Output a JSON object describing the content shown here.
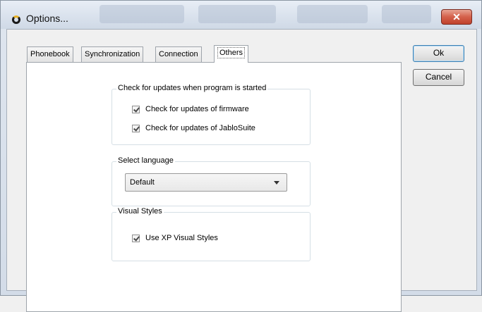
{
  "window": {
    "title": "Options...",
    "close_label": "✕",
    "close_color": "#c0422c"
  },
  "tabs": [
    {
      "label": "Phonebook",
      "active": false
    },
    {
      "label": "Synchronization",
      "active": false
    },
    {
      "label": "Connection",
      "active": false
    },
    {
      "label": "Others",
      "active": true
    }
  ],
  "buttons": {
    "ok_label": "Ok",
    "cancel_label": "Cancel"
  },
  "updates_group": {
    "label": "Check for updates when program is started",
    "items": [
      {
        "label": "Check for updates of firmware",
        "checked": true
      },
      {
        "label": "Check for updates of JabloSuite",
        "checked": true
      }
    ]
  },
  "language_group": {
    "label": "Select language",
    "selected": "Default"
  },
  "styles_group": {
    "label": "Visual Styles",
    "items": [
      {
        "label": "Use XP Visual Styles",
        "checked": true
      }
    ]
  }
}
